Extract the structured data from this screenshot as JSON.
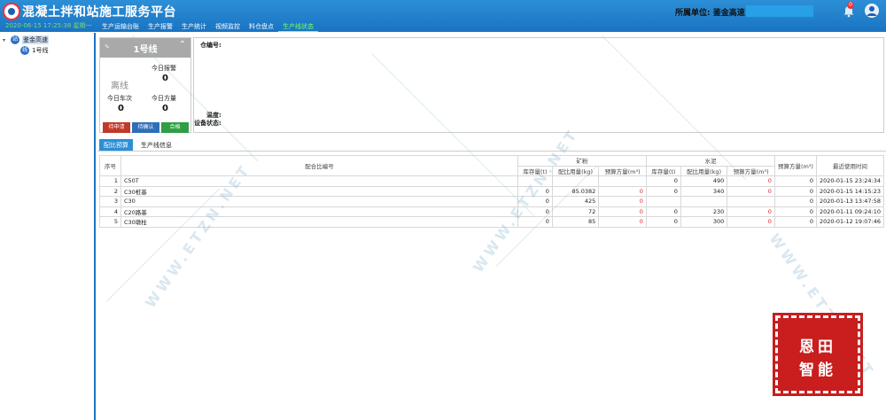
{
  "header": {
    "app_title": "混凝土拌和站施工服务平台",
    "datetime": "2020-06-15 17:25:38 星期一",
    "unit_label": "所属单位: 鉴金高速",
    "bell_count": "0"
  },
  "nav": [
    "生产运输台账",
    "生产报警",
    "生产统计",
    "视频监控",
    "料仓盘点",
    "生产线状态"
  ],
  "sidebar": {
    "root": {
      "icon": "站",
      "label": "鉴金高速"
    },
    "child": {
      "icon": "线",
      "label": "1号线"
    }
  },
  "line_card": {
    "title": "1号线",
    "status": "离线",
    "today_alarm_label": "今日报警",
    "today_alarm_value": "0",
    "today_trips_label": "今日车次",
    "today_trips_value": "0",
    "today_volume_label": "今日方量",
    "today_volume_value": "0",
    "buttons": [
      "待申请",
      "待确认",
      "合格"
    ],
    "button_colors": [
      "#c0392b",
      "#2e6fb7",
      "#2f9e44"
    ]
  },
  "detail": {
    "bin_label": "仓编号:",
    "temp_label": "温度:",
    "device_label": "设备状态:"
  },
  "tabs": [
    "配比预算",
    "生产线信息"
  ],
  "table": {
    "headers": {
      "index": "序号",
      "mix_code": "配合比编号",
      "group1": "矿粉",
      "group2": "水泥",
      "stock": "库存量(t)",
      "usage": "配比用量(kg)",
      "volume": "预算方量(m³)",
      "volume_total": "预算方量(m³)",
      "last_used": "最近使用时间"
    },
    "rows": [
      {
        "idx": "1",
        "code": "C50T",
        "s1": "",
        "u1": "",
        "v1": "",
        "s2": "0",
        "u2": "490",
        "v2": "0",
        "vt": "0",
        "time": "2020-01-15 23:24:34"
      },
      {
        "idx": "2",
        "code": "C30桩基",
        "s1": "0",
        "u1": "85.0382",
        "v1": "0",
        "s2": "0",
        "u2": "340",
        "v2": "0",
        "vt": "0",
        "time": "2020-01-15 14:15:23"
      },
      {
        "idx": "3",
        "code": "C30",
        "s1": "0",
        "u1": "425",
        "v1": "0",
        "s2": "",
        "u2": "",
        "v2": "",
        "vt": "0",
        "time": "2020-01-13 13:47:58"
      },
      {
        "idx": "4",
        "code": "C20路基",
        "s1": "0",
        "u1": "72",
        "v1": "0",
        "s2": "0",
        "u2": "230",
        "v2": "0",
        "vt": "0",
        "time": "2020-01-11 09:24:10"
      },
      {
        "idx": "5",
        "code": "C30墩柱",
        "s1": "0",
        "u1": "85",
        "v1": "0",
        "s2": "0",
        "u2": "300",
        "v2": "0",
        "vt": "0",
        "time": "2020-01-12 19:07:46"
      }
    ]
  },
  "watermark_text": "WWW.ETZN.NET",
  "stamp": {
    "line1": "恩田",
    "line2": "智能"
  }
}
